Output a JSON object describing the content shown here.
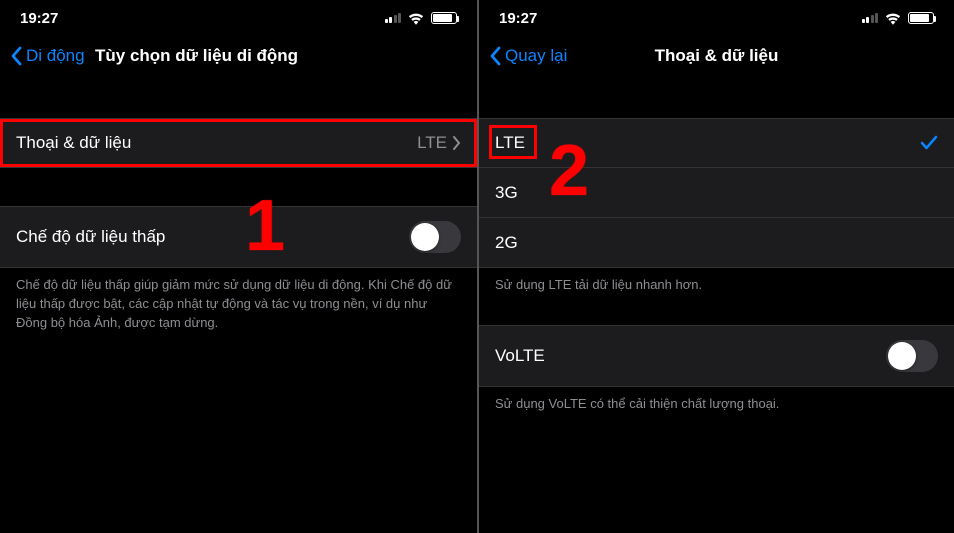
{
  "status": {
    "time": "19:27"
  },
  "phone1": {
    "back_label": "Di động",
    "title": "Tùy chọn dữ liệu di động",
    "row_voice_data_label": "Thoại & dữ liệu",
    "row_voice_data_value": "LTE",
    "row_low_data_label": "Chế độ dữ liệu thấp",
    "low_data_description": "Chế độ dữ liệu thấp giúp giảm mức sử dụng dữ liệu di động. Khi Chế độ dữ liệu thấp được bật, các cập nhật tự động và tác vụ trong nền, ví dụ như Đồng bộ hóa Ảnh, được tạm dừng.",
    "annotation": "1"
  },
  "phone2": {
    "back_label": "Quay lại",
    "title": "Thoại & dữ liệu",
    "options": {
      "lte": "LTE",
      "g3": "3G",
      "g2": "2G"
    },
    "lte_footer": "Sử dụng LTE tải dữ liệu nhanh hơn.",
    "volte_label": "VoLTE",
    "volte_footer": "Sử dụng VoLTE có thể cải thiện chất lượng thoại.",
    "annotation": "2"
  }
}
